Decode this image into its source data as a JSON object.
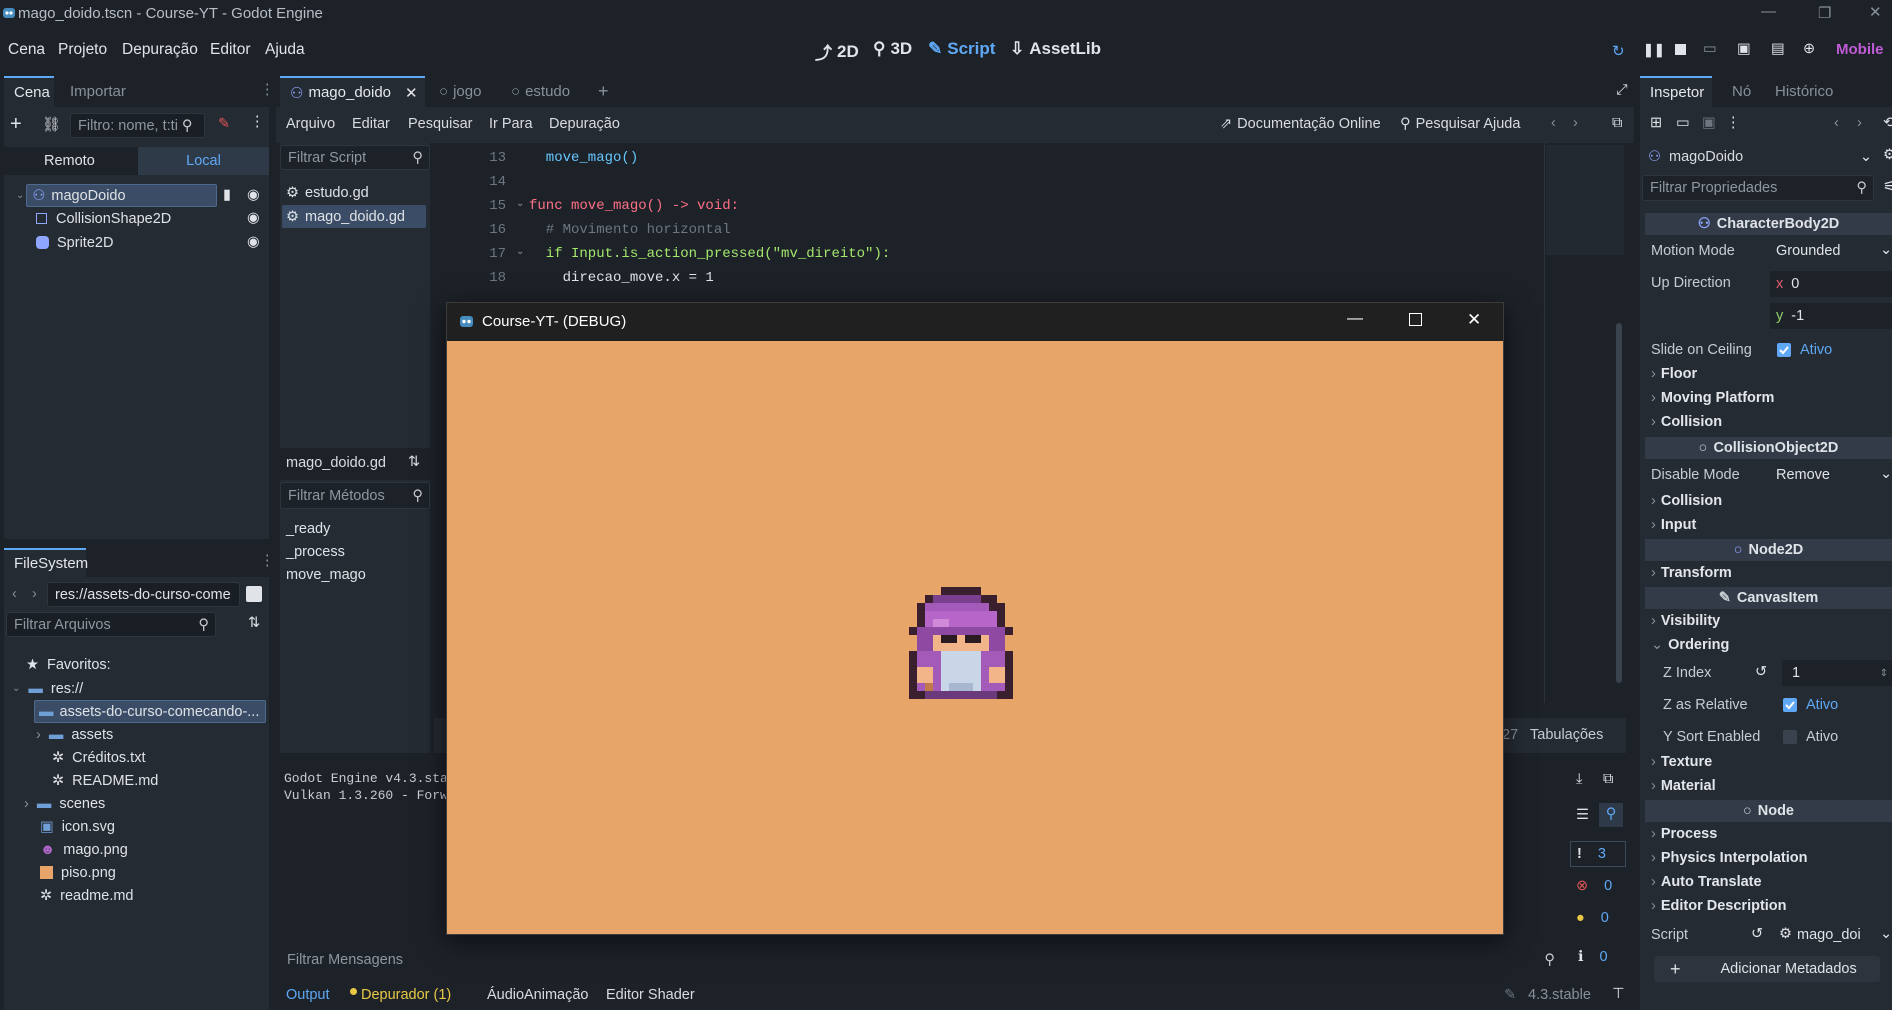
{
  "window": {
    "title": "mago_doido.tscn - Course-YT - Godot Engine"
  },
  "menu": [
    "Cena",
    "Projeto",
    "Depuração",
    "Editor",
    "Ajuda"
  ],
  "workspaces": {
    "w2d": "2D",
    "w3d": "3D",
    "script": "Script",
    "assetlib": "AssetLib"
  },
  "renderer": "Mobile",
  "scene_panel": {
    "tabs": [
      "Cena",
      "Importar"
    ],
    "filter_placeholder": "Filtro: nome, t:ti",
    "remote": "Remoto",
    "local": "Local",
    "nodes": [
      {
        "label": "magoDoido"
      },
      {
        "label": "CollisionShape2D"
      },
      {
        "label": "Sprite2D"
      }
    ]
  },
  "filesystem": {
    "title": "FileSystem",
    "path": "res://assets-do-curso-come",
    "filter_placeholder": "Filtrar Arquivos",
    "items": [
      "Favoritos:",
      "res://",
      "assets-do-curso-comecando-...",
      "assets",
      "Créditos.txt",
      "README.md",
      "scenes",
      "icon.svg",
      "mago.png",
      "piso.png",
      "readme.md"
    ]
  },
  "editor_tabs": [
    "mago_doido",
    "jogo",
    "estudo"
  ],
  "script_menu": [
    "Arquivo",
    "Editar",
    "Pesquisar",
    "Ir Para",
    "Depuração"
  ],
  "online_docs": "Documentação Online",
  "search_help": "Pesquisar Ajuda",
  "script_list": {
    "filter_placeholder": "Filtrar Script",
    "files": [
      "estudo.gd",
      "mago_doido.gd"
    ],
    "current": "mago_doido.gd",
    "methods_filter": "Filtrar Métodos",
    "methods": [
      "_ready",
      "_process",
      "move_mago"
    ]
  },
  "code": {
    "lines": [
      {
        "n": "13",
        "text": "  move_mago()"
      },
      {
        "n": "14",
        "text": ""
      },
      {
        "n": "15",
        "text": "func move_mago() -> void:"
      },
      {
        "n": "16",
        "text": "  # Movimento horizontal"
      },
      {
        "n": "17",
        "text": "  if Input.is_action_pressed(\"mv_direito\"):"
      },
      {
        "n": "18",
        "text": "    direcao_move.x = 1"
      }
    ],
    "status_col": "27",
    "indent": "Tabulações"
  },
  "output": {
    "lines": [
      "Godot Engine v4.3.sta",
      "Vulkan 1.3.260 - Forw"
    ],
    "filter_placeholder": "Filtrar Mensagens",
    "counts": [
      "3",
      "0",
      "0",
      "0"
    ]
  },
  "bottom_tabs": [
    "Output",
    "Depurador (1)",
    "Áudio",
    "Animação",
    "Editor Shader"
  ],
  "version": "4.3.stable",
  "debug_window": {
    "title": "Course-YT- (DEBUG)",
    "bg": "#e8a56a"
  },
  "inspector": {
    "tabs": [
      "Inspetor",
      "Nó",
      "Histórico"
    ],
    "node": "magoDoido",
    "filter_placeholder": "Filtrar Propriedades",
    "class1": "CharacterBody2D",
    "motion_mode_label": "Motion Mode",
    "motion_mode": "Grounded",
    "up_direction_label": "Up Direction",
    "up_x": "0",
    "up_y": "-1",
    "slide_label": "Slide on Ceiling",
    "on_label": "Ativo",
    "groups1": [
      "Floor",
      "Moving Platform",
      "Collision"
    ],
    "class2": "CollisionObject2D",
    "disable_mode_label": "Disable Mode",
    "disable_mode": "Remove",
    "groups2": [
      "Collision",
      "Input"
    ],
    "class3": "Node2D",
    "groups3": [
      "Transform"
    ],
    "class4": "CanvasItem",
    "groups4": [
      "Visibility",
      "Ordering"
    ],
    "z_index_label": "Z Index",
    "z_index": "1",
    "z_rel_label": "Z as Relative",
    "ysort_label": "Y Sort Enabled",
    "groups5": [
      "Texture",
      "Material"
    ],
    "class5": "Node",
    "groups6": [
      "Process",
      "Physics Interpolation",
      "Auto Translate",
      "Editor Description"
    ],
    "script_label": "Script",
    "script_value": "mago_doi",
    "add_meta": "Adicionar Metadados"
  },
  "colors": {
    "accent": "#5fa8f5",
    "bg": "#1d2229",
    "panel": "#252b33"
  }
}
